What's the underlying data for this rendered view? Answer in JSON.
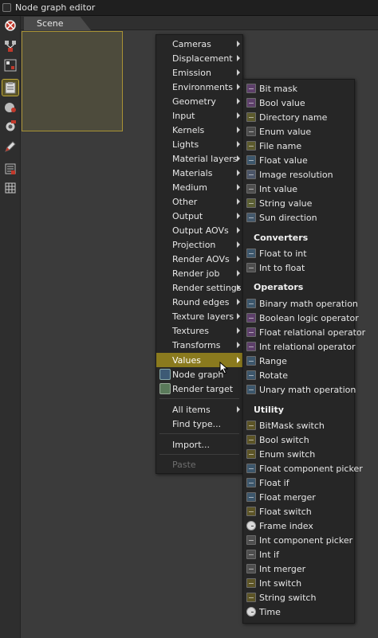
{
  "window": {
    "title": "Node graph editor"
  },
  "tabs": [
    {
      "label": "Scene"
    }
  ],
  "toolbar": {
    "tools": [
      {
        "icon": "graph-settings-icon"
      },
      {
        "icon": "node-layout-icon"
      },
      {
        "icon": "nodes-grid-icon"
      },
      {
        "icon": "clipboard-icon"
      },
      {
        "icon": "material-icon"
      },
      {
        "icon": "camera-icon"
      },
      {
        "icon": "pencil-icon"
      },
      {
        "icon": "magnet-icon"
      },
      {
        "icon": "table-icon"
      }
    ]
  },
  "main_menu": {
    "items": [
      {
        "label": "Cameras",
        "submenu": true
      },
      {
        "label": "Displacement",
        "submenu": true
      },
      {
        "label": "Emission",
        "submenu": true
      },
      {
        "label": "Environments",
        "submenu": true
      },
      {
        "label": "Geometry",
        "submenu": true
      },
      {
        "label": "Input",
        "submenu": true
      },
      {
        "label": "Kernels",
        "submenu": true
      },
      {
        "label": "Lights",
        "submenu": true
      },
      {
        "label": "Material layers",
        "submenu": true
      },
      {
        "label": "Materials",
        "submenu": true
      },
      {
        "label": "Medium",
        "submenu": true
      },
      {
        "label": "Other",
        "submenu": true
      },
      {
        "label": "Output",
        "submenu": true
      },
      {
        "label": "Output AOVs",
        "submenu": true
      },
      {
        "label": "Projection",
        "submenu": true
      },
      {
        "label": "Render AOVs",
        "submenu": true
      },
      {
        "label": "Render job",
        "submenu": true
      },
      {
        "label": "Render settings",
        "submenu": true
      },
      {
        "label": "Round edges",
        "submenu": true
      },
      {
        "label": "Texture layers",
        "submenu": true
      },
      {
        "label": "Textures",
        "submenu": true
      },
      {
        "label": "Transforms",
        "submenu": true
      },
      {
        "label": "Values",
        "submenu": true,
        "highlighted": true
      }
    ],
    "node_graph": "Node graph",
    "render_target": "Render target",
    "all_items": "All items",
    "find_type": "Find type...",
    "import": "Import...",
    "paste": "Paste"
  },
  "values_submenu": {
    "items": [
      {
        "label": "Bit mask",
        "icon": "bit-mask-icon"
      },
      {
        "label": "Bool value",
        "icon": "bool-icon"
      },
      {
        "label": "Directory name",
        "icon": "directory-icon"
      },
      {
        "label": "Enum value",
        "icon": "enum-icon"
      },
      {
        "label": "File name",
        "icon": "file-icon"
      },
      {
        "label": "Float value",
        "icon": "float-icon"
      },
      {
        "label": "Image resolution",
        "icon": "image-resolution-icon"
      },
      {
        "label": "Int value",
        "icon": "int-icon"
      },
      {
        "label": "String value",
        "icon": "string-icon"
      },
      {
        "label": "Sun direction",
        "icon": "sun-direction-icon"
      }
    ],
    "converters_header": "Converters",
    "converters": [
      {
        "label": "Float to int",
        "icon": "float-icon"
      },
      {
        "label": "Int to float",
        "icon": "int-icon"
      }
    ],
    "operators_header": "Operators",
    "operators": [
      {
        "label": "Binary math operation",
        "icon": "float-icon"
      },
      {
        "label": "Boolean logic operator",
        "icon": "bool-icon"
      },
      {
        "label": "Float relational operator",
        "icon": "bit-mask-icon"
      },
      {
        "label": "Int relational operator",
        "icon": "bit-mask-icon"
      },
      {
        "label": "Range",
        "icon": "float-icon"
      },
      {
        "label": "Rotate",
        "icon": "float-icon"
      },
      {
        "label": "Unary math operation",
        "icon": "float-icon"
      }
    ],
    "utility_header": "Utility",
    "utility": [
      {
        "label": "BitMask switch",
        "icon": "switch-icon"
      },
      {
        "label": "Bool switch",
        "icon": "switch-icon"
      },
      {
        "label": "Enum switch",
        "icon": "switch-icon"
      },
      {
        "label": "Float component picker",
        "icon": "float-icon"
      },
      {
        "label": "Float if",
        "icon": "float-icon"
      },
      {
        "label": "Float merger",
        "icon": "float-icon"
      },
      {
        "label": "Float switch",
        "icon": "switch-icon"
      },
      {
        "label": "Frame index",
        "icon": "clock-icon"
      },
      {
        "label": "Int component picker",
        "icon": "int-icon"
      },
      {
        "label": "Int if",
        "icon": "int-icon"
      },
      {
        "label": "Int merger",
        "icon": "int-icon"
      },
      {
        "label": "Int switch",
        "icon": "switch-icon"
      },
      {
        "label": "String switch",
        "icon": "switch-icon"
      },
      {
        "label": "Time",
        "icon": "clock-icon"
      }
    ]
  },
  "colors": {
    "accent": "#8a7a1e",
    "node_border": "#a89235"
  }
}
